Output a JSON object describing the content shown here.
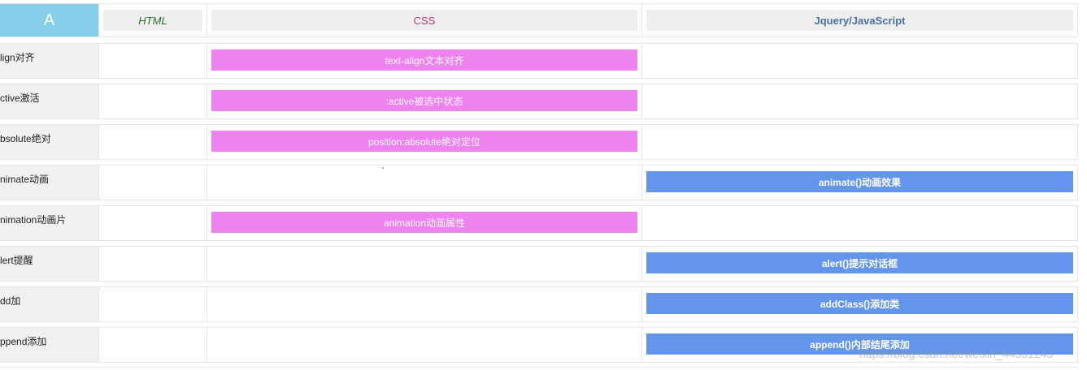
{
  "header": {
    "letter": "A",
    "html": "HTML",
    "css": "CSS",
    "js": "Jquery/JavaScript"
  },
  "rows": [
    {
      "label": "lign对齐",
      "html": "",
      "css": "text-align文本对齐",
      "js": ""
    },
    {
      "label": "ctive激活",
      "html": "",
      "css": ":active被选中状态",
      "js": ""
    },
    {
      "label": "bsolute绝对",
      "html": "",
      "css": "position:absolute绝对定位",
      "js": ""
    },
    {
      "label": "nimate动画",
      "html": "",
      "css": "",
      "js": "animate()动画效果"
    },
    {
      "label": "nimation动画片",
      "html": "",
      "css": "animation动画属性",
      "js": ""
    },
    {
      "label": "lert提醒",
      "html": "",
      "css": "",
      "js": "alert()提示对话框"
    },
    {
      "label": "dd加",
      "html": "",
      "css": "",
      "js": "addClass()添加类"
    },
    {
      "label": "ppend添加",
      "html": "",
      "css": "",
      "js": "append()内部结尾添加"
    }
  ],
  "watermark": "https://blog.csdn.net/weixin_44331243",
  "colors": {
    "letter_bg": "#87ceeb",
    "css_pill": "#ee82ee",
    "js_pill": "#6495ed",
    "label_bg": "#f1f1f1"
  }
}
